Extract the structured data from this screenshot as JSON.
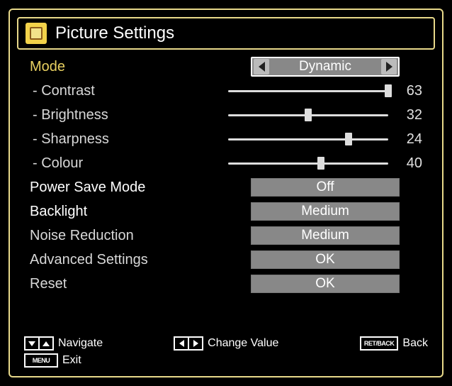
{
  "title": "Picture Settings",
  "mode": {
    "label": "Mode",
    "value": "Dynamic"
  },
  "sliders": {
    "contrast": {
      "label": "- Contrast",
      "value": 63,
      "pct": 100
    },
    "brightness": {
      "label": "- Brightness",
      "value": 32,
      "pct": 50
    },
    "sharpness": {
      "label": "- Sharpness",
      "value": 24,
      "pct": 75
    },
    "colour": {
      "label": "- Colour",
      "value": 40,
      "pct": 58
    }
  },
  "options": {
    "power_save": {
      "label": "Power Save Mode",
      "value": "Off"
    },
    "backlight": {
      "label": "Backlight",
      "value": "Medium"
    },
    "noise_reduction": {
      "label": "Noise Reduction",
      "value": "Medium"
    },
    "advanced": {
      "label": "Advanced Settings",
      "value": "OK"
    },
    "reset": {
      "label": "Reset",
      "value": "OK"
    }
  },
  "hints": {
    "navigate": "Navigate",
    "change_value": "Change Value",
    "back_key": "RET/BACK",
    "back": "Back",
    "menu_key": "MENU",
    "exit": "Exit"
  }
}
